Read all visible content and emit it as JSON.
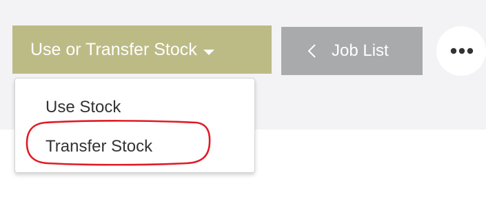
{
  "toolbar": {
    "primary_button_label": "Use or Transfer Stock",
    "job_list_label": "Job List",
    "more_icon": "ellipsis-icon",
    "caret_icon": "caret-down-icon",
    "back_icon": "chevron-left-icon"
  },
  "dropdown": {
    "items": [
      {
        "label": "Use Stock"
      },
      {
        "label": "Transfer Stock"
      }
    ],
    "highlighted_item": "Transfer Stock"
  },
  "colors": {
    "primary_button": "#bcbb86",
    "job_list_button": "#a9aaac",
    "background_band": "#f3f3f5",
    "highlight_ring": "#e01b24"
  }
}
